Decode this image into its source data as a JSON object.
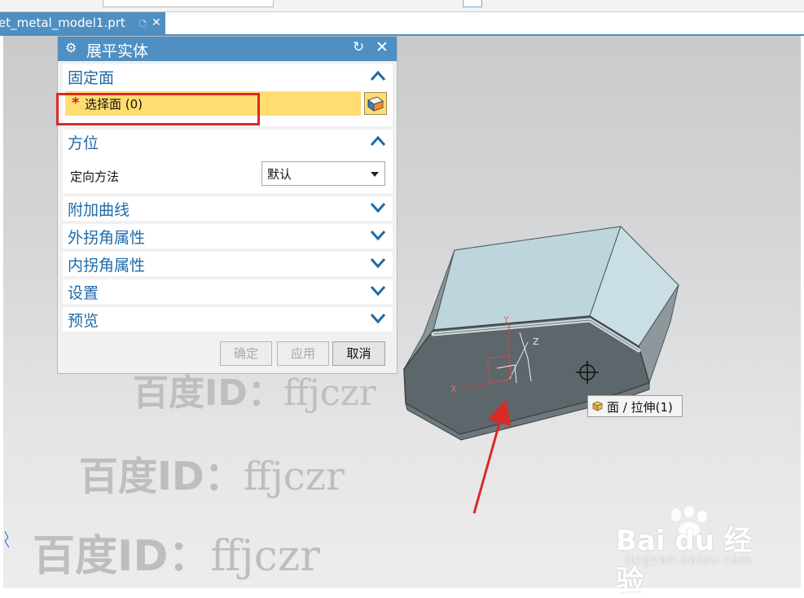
{
  "document_tab": {
    "file_name": "et_metal_model1.prt",
    "doc_icon": "document-icon",
    "close_icon": "close-icon"
  },
  "dialog": {
    "title": "展平实体",
    "settings_icon": "gear-icon",
    "reset_icon": "reset-icon",
    "close_icon": "close-icon",
    "sections": {
      "fixed_face": {
        "label": "固定面",
        "expanded": true,
        "select_face": {
          "required_marker": "*",
          "label": "选择面 (0)",
          "icon": "select-face-icon"
        }
      },
      "orientation": {
        "label": "方位",
        "expanded": true,
        "method_label": "定向方法",
        "method_value": "默认"
      },
      "extra_curves": {
        "label": "附加曲线",
        "expanded": false
      },
      "outer_corner": {
        "label": "外拐角属性",
        "expanded": false
      },
      "inner_corner": {
        "label": "内拐角属性",
        "expanded": false
      },
      "settings": {
        "label": "设置",
        "expanded": false
      },
      "preview": {
        "label": "预览",
        "expanded": false
      }
    },
    "buttons": {
      "ok": "确定",
      "apply": "应用",
      "cancel": "取消"
    }
  },
  "viewport": {
    "csys_axes": {
      "x": "X",
      "y": "Y",
      "z": "Z"
    },
    "tooltip": {
      "icon": "face-cube-icon",
      "text": "面 / 拉伸(1)"
    },
    "cursor": "crosshair-cursor-icon"
  },
  "watermarks": {
    "prefix": "百度ID：",
    "user": "ffjczr"
  },
  "site_logo": {
    "brand": "Bai du 经验",
    "url": "jingyan.baidu.com"
  },
  "colors": {
    "accent": "#4f8fc2",
    "section_title": "#1f6aa8",
    "selection_highlight": "#ffdd70",
    "annotation_red": "#d92a2a",
    "part_top": "#bdd5dc",
    "part_bottom": "#5d666b"
  }
}
